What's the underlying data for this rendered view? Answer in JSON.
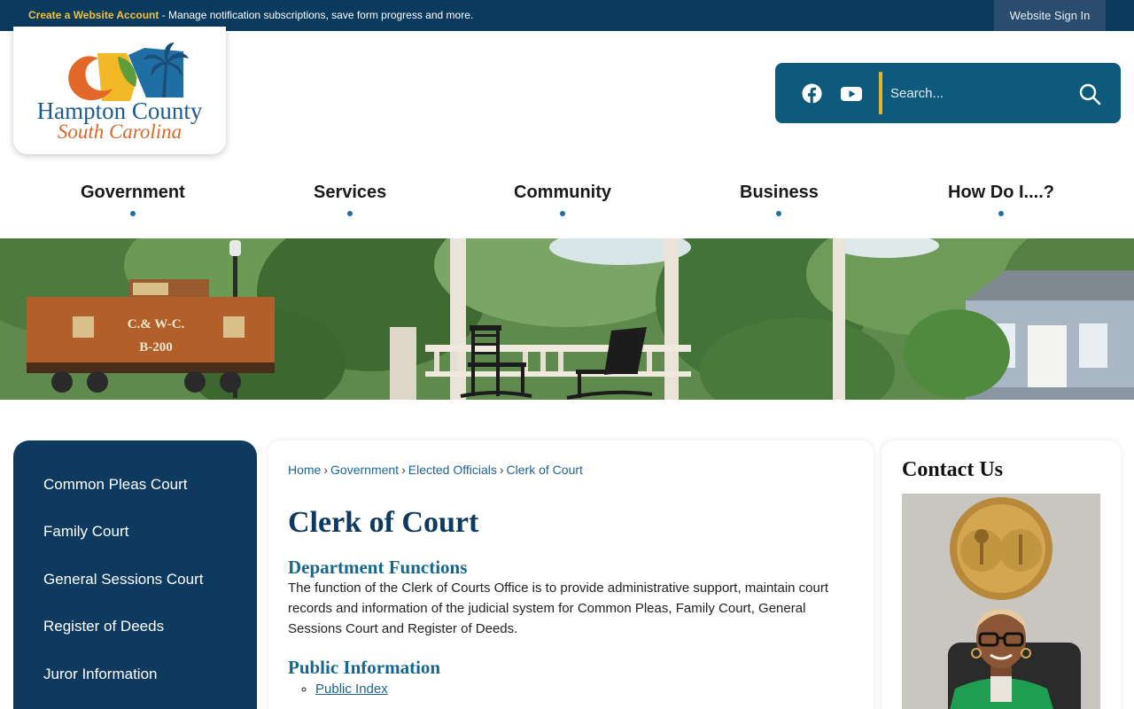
{
  "topbar": {
    "create_account": "Create a Website Account",
    "message": " - Manage notification subscriptions, save form progress and more.",
    "sign_in": "Website Sign In"
  },
  "logo": {
    "line1": "Hampton County",
    "line2": "South Carolina"
  },
  "tools": {
    "facebook": "facebook-icon",
    "youtube": "youtube-icon",
    "search_placeholder": "Search...",
    "search_icon": "search-icon"
  },
  "nav": {
    "items": [
      {
        "label": "Government"
      },
      {
        "label": "Services"
      },
      {
        "label": "Community"
      },
      {
        "label": "Business"
      },
      {
        "label": "How Do I....?"
      }
    ]
  },
  "banner": {
    "caboose_text1": "C.& W-C.",
    "caboose_text2": "B-200"
  },
  "sidebar": {
    "items": [
      {
        "label": "Common Pleas Court"
      },
      {
        "label": "Family Court"
      },
      {
        "label": "General Sessions Court"
      },
      {
        "label": "Register of Deeds"
      },
      {
        "label": "Juror Information"
      }
    ]
  },
  "breadcrumb": {
    "items": [
      "Home",
      "Government",
      "Elected Officials",
      "Clerk of Court"
    ],
    "separator": "›"
  },
  "main": {
    "title": "Clerk of Court",
    "functions_heading": "Department Functions",
    "functions_text": "The function of the Clerk of Courts Office is to provide administrative support, maintain court records and information of the judicial system for Common Pleas, Family Court, General Sessions Court and Register of Deeds.",
    "public_heading": "Public Information",
    "public_links": [
      "Public Index"
    ]
  },
  "contact": {
    "title": "Contact Us"
  },
  "colors": {
    "topbar": "#0b3a5f",
    "accent_yellow": "#f4c13a",
    "tools_bg": "#0d5a7c",
    "sidebar_bg": "#0e3a60",
    "heading_teal": "#15678e",
    "logo_blue": "#1d5c8a",
    "logo_orange": "#d9692b"
  }
}
